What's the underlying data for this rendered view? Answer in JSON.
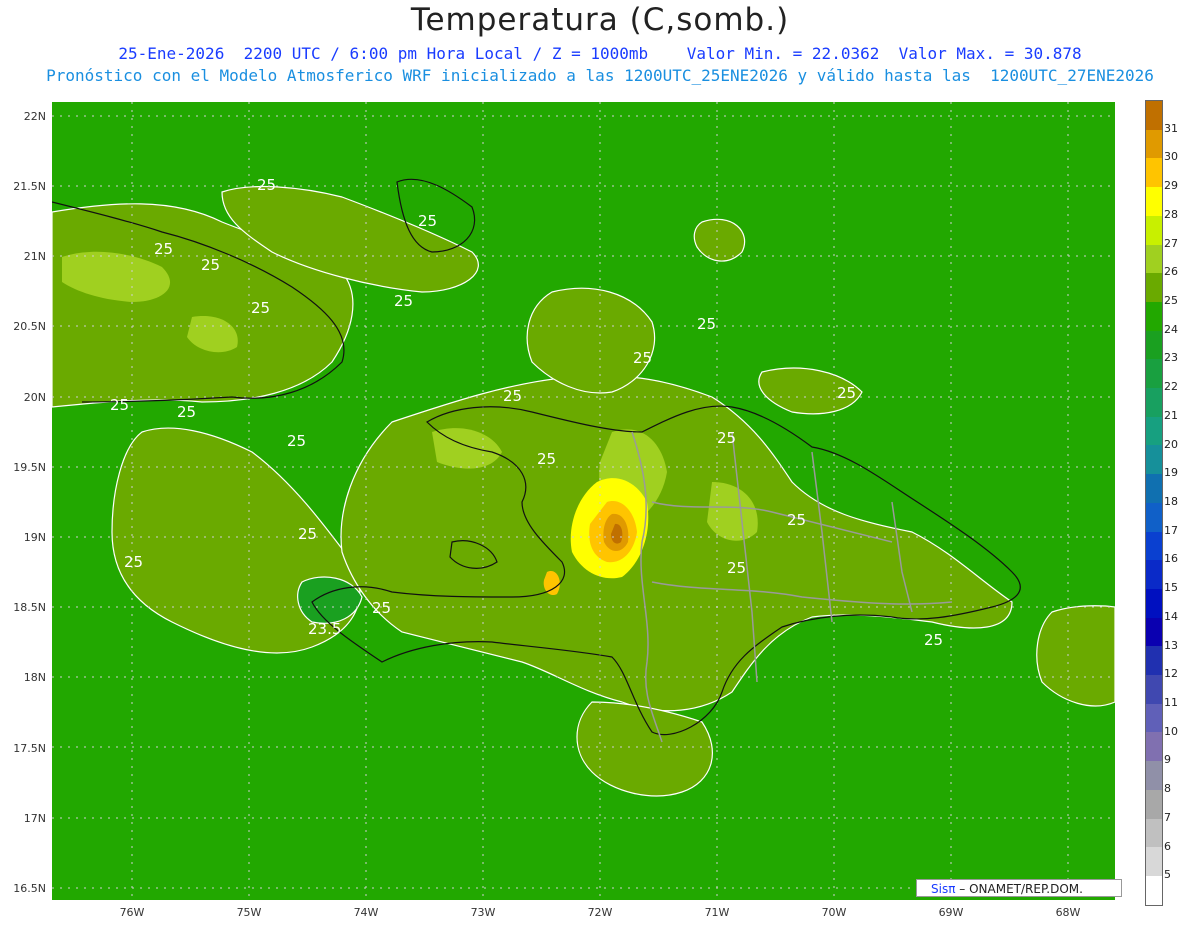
{
  "title": "Temperatura (C,somb.)",
  "subtitle_line1": "25-Ene-2026  2200 UTC / 6:00 pm Hora Local / Z = 1000mb    Valor Min. = 22.0362  Valor Max. = 30.878",
  "subtitle_line2": "Pronóstico con el Modelo Atmosferico WRF inicializado a las 1200UTC_25ENE2026 y válido hasta las  1200UTC_27ENE2026",
  "lat_labels": [
    "22N",
    "21.5N",
    "21N",
    "20.5N",
    "20N",
    "19.5N",
    "19N",
    "18.5N",
    "18N",
    "17.5N",
    "17N",
    "16.5N"
  ],
  "lon_labels": [
    "76W",
    "75W",
    "74W",
    "73W",
    "72W",
    "71W",
    "70W",
    "69W",
    "68W"
  ],
  "colorbar": {
    "labels": [
      "31",
      "30",
      "29",
      "28",
      "27",
      "26",
      "25",
      "24",
      "23",
      "22",
      "21",
      "20",
      "19",
      "18",
      "17",
      "16",
      "15",
      "14",
      "13",
      "12",
      "11",
      "10",
      "9",
      "8",
      "7",
      "6",
      "5"
    ],
    "colors": [
      "#c07000",
      "#e09a00",
      "#ffc400",
      "#ffff00",
      "#c8f000",
      "#a0d020",
      "#6aaa00",
      "#22a800",
      "#1aa020",
      "#19a040",
      "#18a060",
      "#17a080",
      "#16909a",
      "#1070b0",
      "#1060c8",
      "#0a40d0",
      "#0a2ac8",
      "#0010c0",
      "#0a00b0",
      "#2030b0",
      "#4048b0",
      "#6060b8",
      "#8070b0",
      "#9090a8",
      "#a8a8a8",
      "#c0c0c0",
      "#d8d8d8",
      "#ffffff"
    ]
  },
  "contour_labels": [
    "25",
    "25",
    "25",
    "25",
    "25",
    "25",
    "25",
    "25",
    "25",
    "25",
    "25",
    "25",
    "25",
    "25",
    "25",
    "25",
    "25",
    "25",
    "25",
    "25",
    "25",
    "23.5"
  ],
  "credit": {
    "sis": "Sisπ",
    "rest": "– ONAMET/REP.DOM."
  },
  "colors": {
    "ocean": "#22a800",
    "land_warm": "#6aaa00",
    "hot": "#ffc400",
    "hottest": "#c07000"
  }
}
